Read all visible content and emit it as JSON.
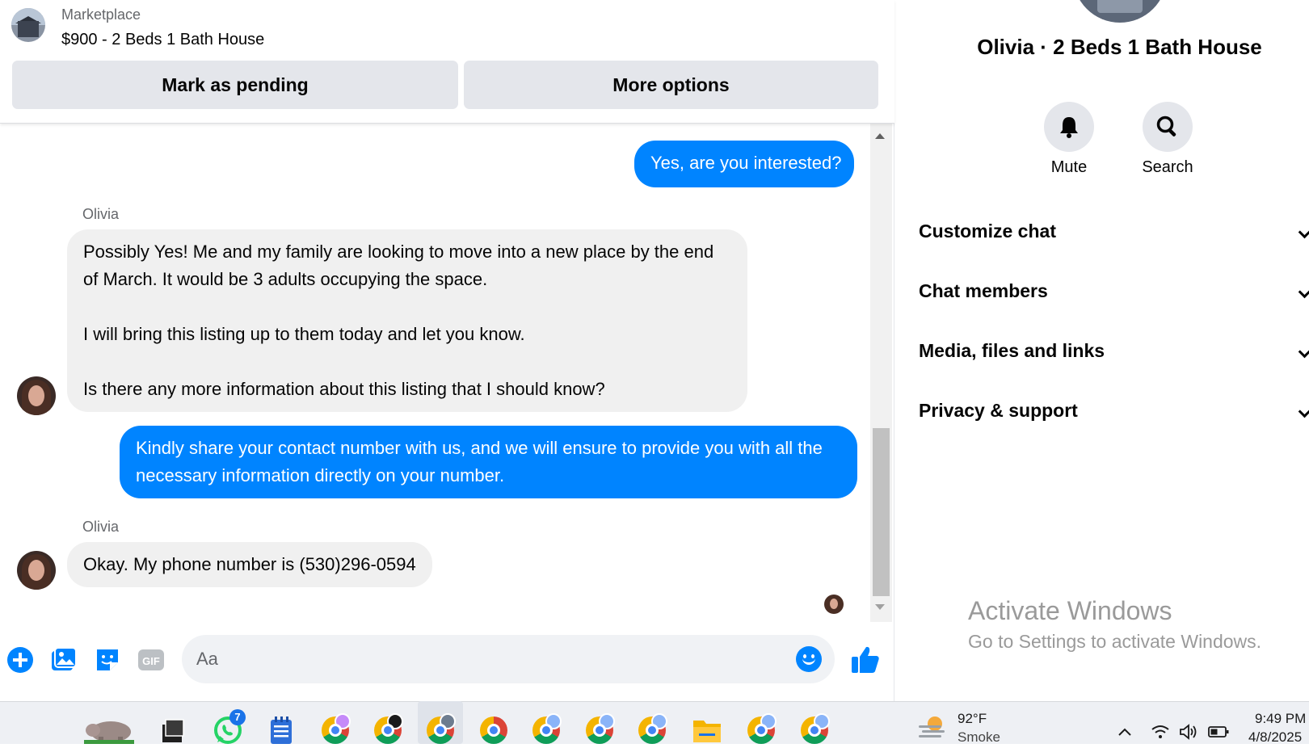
{
  "listing": {
    "source": "Marketplace",
    "title": "$900 - 2 Beds 1 Bath House",
    "mark_pending_label": "Mark as pending",
    "more_options_label": "More options"
  },
  "messages": [
    {
      "from": "me",
      "text": "Yes, are you interested?"
    },
    {
      "from": "Olivia",
      "sender_label": "Olivia",
      "paragraphs": [
        "Possibly Yes! Me and my family are looking to move into a new place by the end of March. It would be 3 adults occupying the space.",
        "I will bring this listing up to them today and let you know.",
        "Is there any more information about this listing that I should know?"
      ]
    },
    {
      "from": "me",
      "text": "Kindly share your contact number with us, and we will ensure to provide you with all the necessary information directly on your number."
    },
    {
      "from": "Olivia",
      "sender_label": "Olivia",
      "text": "Okay. My phone number is (530)296-0594"
    }
  ],
  "composer": {
    "placeholder": "Aa",
    "gif_label": "GIF"
  },
  "info": {
    "title": "Olivia · 2 Beds 1 Bath House",
    "mute_label": "Mute",
    "search_label": "Search",
    "sections": [
      "Customize chat",
      "Chat members",
      "Media, files and links",
      "Privacy & support"
    ],
    "watermark_title": "Activate Windows",
    "watermark_sub": "Go to Settings to activate Windows."
  },
  "taskbar": {
    "whatsapp_badge": "7",
    "weather_temp": "92°F",
    "weather_condition": "Smoke",
    "time": "9:49 PM",
    "date": "4/8/2025"
  },
  "colors": {
    "messenger_blue": "#0084ff",
    "incoming_bubble": "#f0f0f0",
    "button_gray": "#e4e6eb"
  },
  "icons": [
    "plus-circle-icon",
    "image-icon",
    "sticker-icon",
    "gif-icon",
    "emoji-icon",
    "thumbs-up-icon",
    "bell-icon",
    "search-icon",
    "chevron-down-icon"
  ]
}
